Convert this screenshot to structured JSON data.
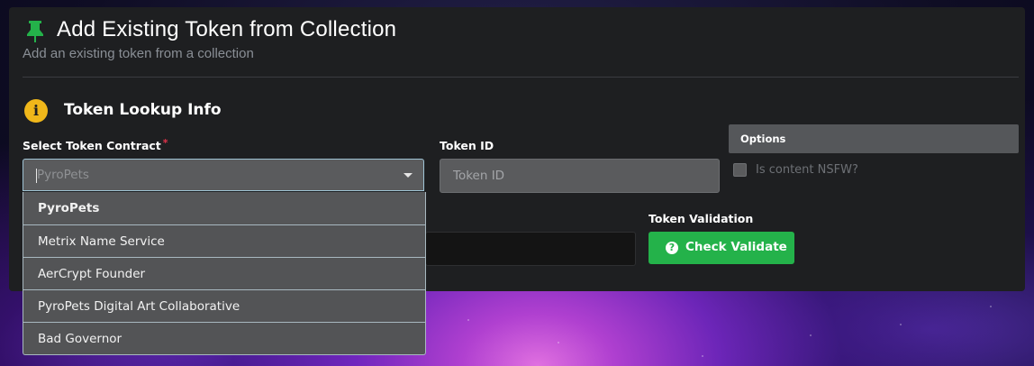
{
  "header": {
    "icon": "pin-icon",
    "title": "Add Existing Token from Collection",
    "subtitle": "Add an existing token from a collection"
  },
  "section": {
    "icon": "info-icon",
    "icon_glyph": "i",
    "title": "Token Lookup Info"
  },
  "contract": {
    "label": "Select Token Contract",
    "required_mark": "*",
    "placeholder": "PyroPets",
    "options": [
      "PyroPets",
      "Metrix Name Service",
      "AerCrypt Founder",
      "PyroPets Digital Art Collaborative",
      "Bad Governor"
    ]
  },
  "token_id": {
    "label": "Token ID",
    "placeholder": "Token ID",
    "value": ""
  },
  "options": {
    "title": "Options",
    "nsfw_label": "Is content NSFW?",
    "nsfw_checked": false
  },
  "validation": {
    "label": "Token Validation",
    "button_label": "Check Validate",
    "button_icon": "question-circle-icon",
    "button_icon_glyph": "?"
  },
  "colors": {
    "panel_bg": "#1e1f21",
    "accent_green": "#24b24a",
    "info_yellow": "#f0b71a",
    "required_red": "#e0324a"
  }
}
